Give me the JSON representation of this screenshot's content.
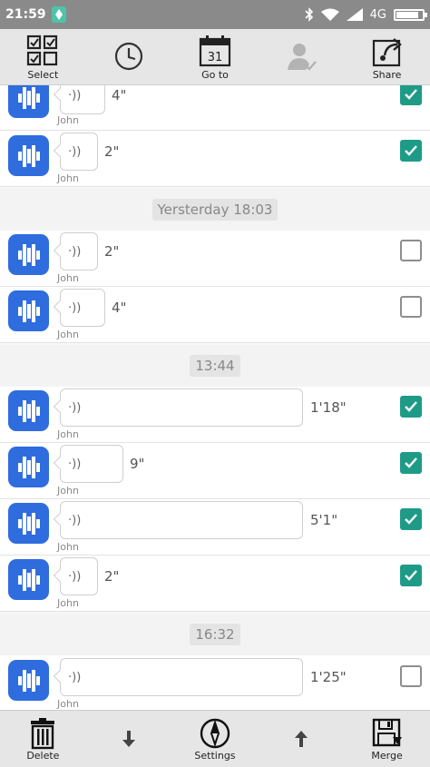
{
  "status_bar": {
    "time": "21:59",
    "network": "4G"
  },
  "toolbar": {
    "select_label": "Select",
    "history_label": "",
    "goto_label": "Go to",
    "calendar_day": "31",
    "contact_label": "",
    "share_label": "Share"
  },
  "messages": [
    {
      "duration": "4\"",
      "sender": "John",
      "checked": true
    },
    {
      "duration": "2\"",
      "sender": "John",
      "checked": true
    },
    {
      "duration": "2\"",
      "sender": "John",
      "checked": false
    },
    {
      "duration": "4\"",
      "sender": "John",
      "checked": false
    },
    {
      "duration": "1'18\"",
      "sender": "John",
      "checked": true
    },
    {
      "duration": "9\"",
      "sender": "John",
      "checked": true
    },
    {
      "duration": "5'1\"",
      "sender": "John",
      "checked": true
    },
    {
      "duration": "2\"",
      "sender": "John",
      "checked": true
    },
    {
      "duration": "1'25\"",
      "sender": "John",
      "checked": false
    }
  ],
  "dividers": [
    "Yersterday 18:03",
    "13:44",
    "16:32"
  ],
  "bottom_bar": {
    "delete_label": "Delete",
    "settings_label": "Settings",
    "merge_label": "Merge"
  },
  "colors": {
    "accent": "#1e9b87",
    "avatar": "#2f6cde",
    "bars": "#8a8a8a"
  },
  "icons": {
    "select": "grid-check-icon",
    "history": "clock-icon",
    "goto": "calendar-icon",
    "contact": "user-check-icon",
    "share": "share-icon",
    "delete": "trash-icon",
    "settings": "compass-icon",
    "merge": "save-merge-icon",
    "down": "arrow-down-icon",
    "up": "arrow-up-icon"
  }
}
